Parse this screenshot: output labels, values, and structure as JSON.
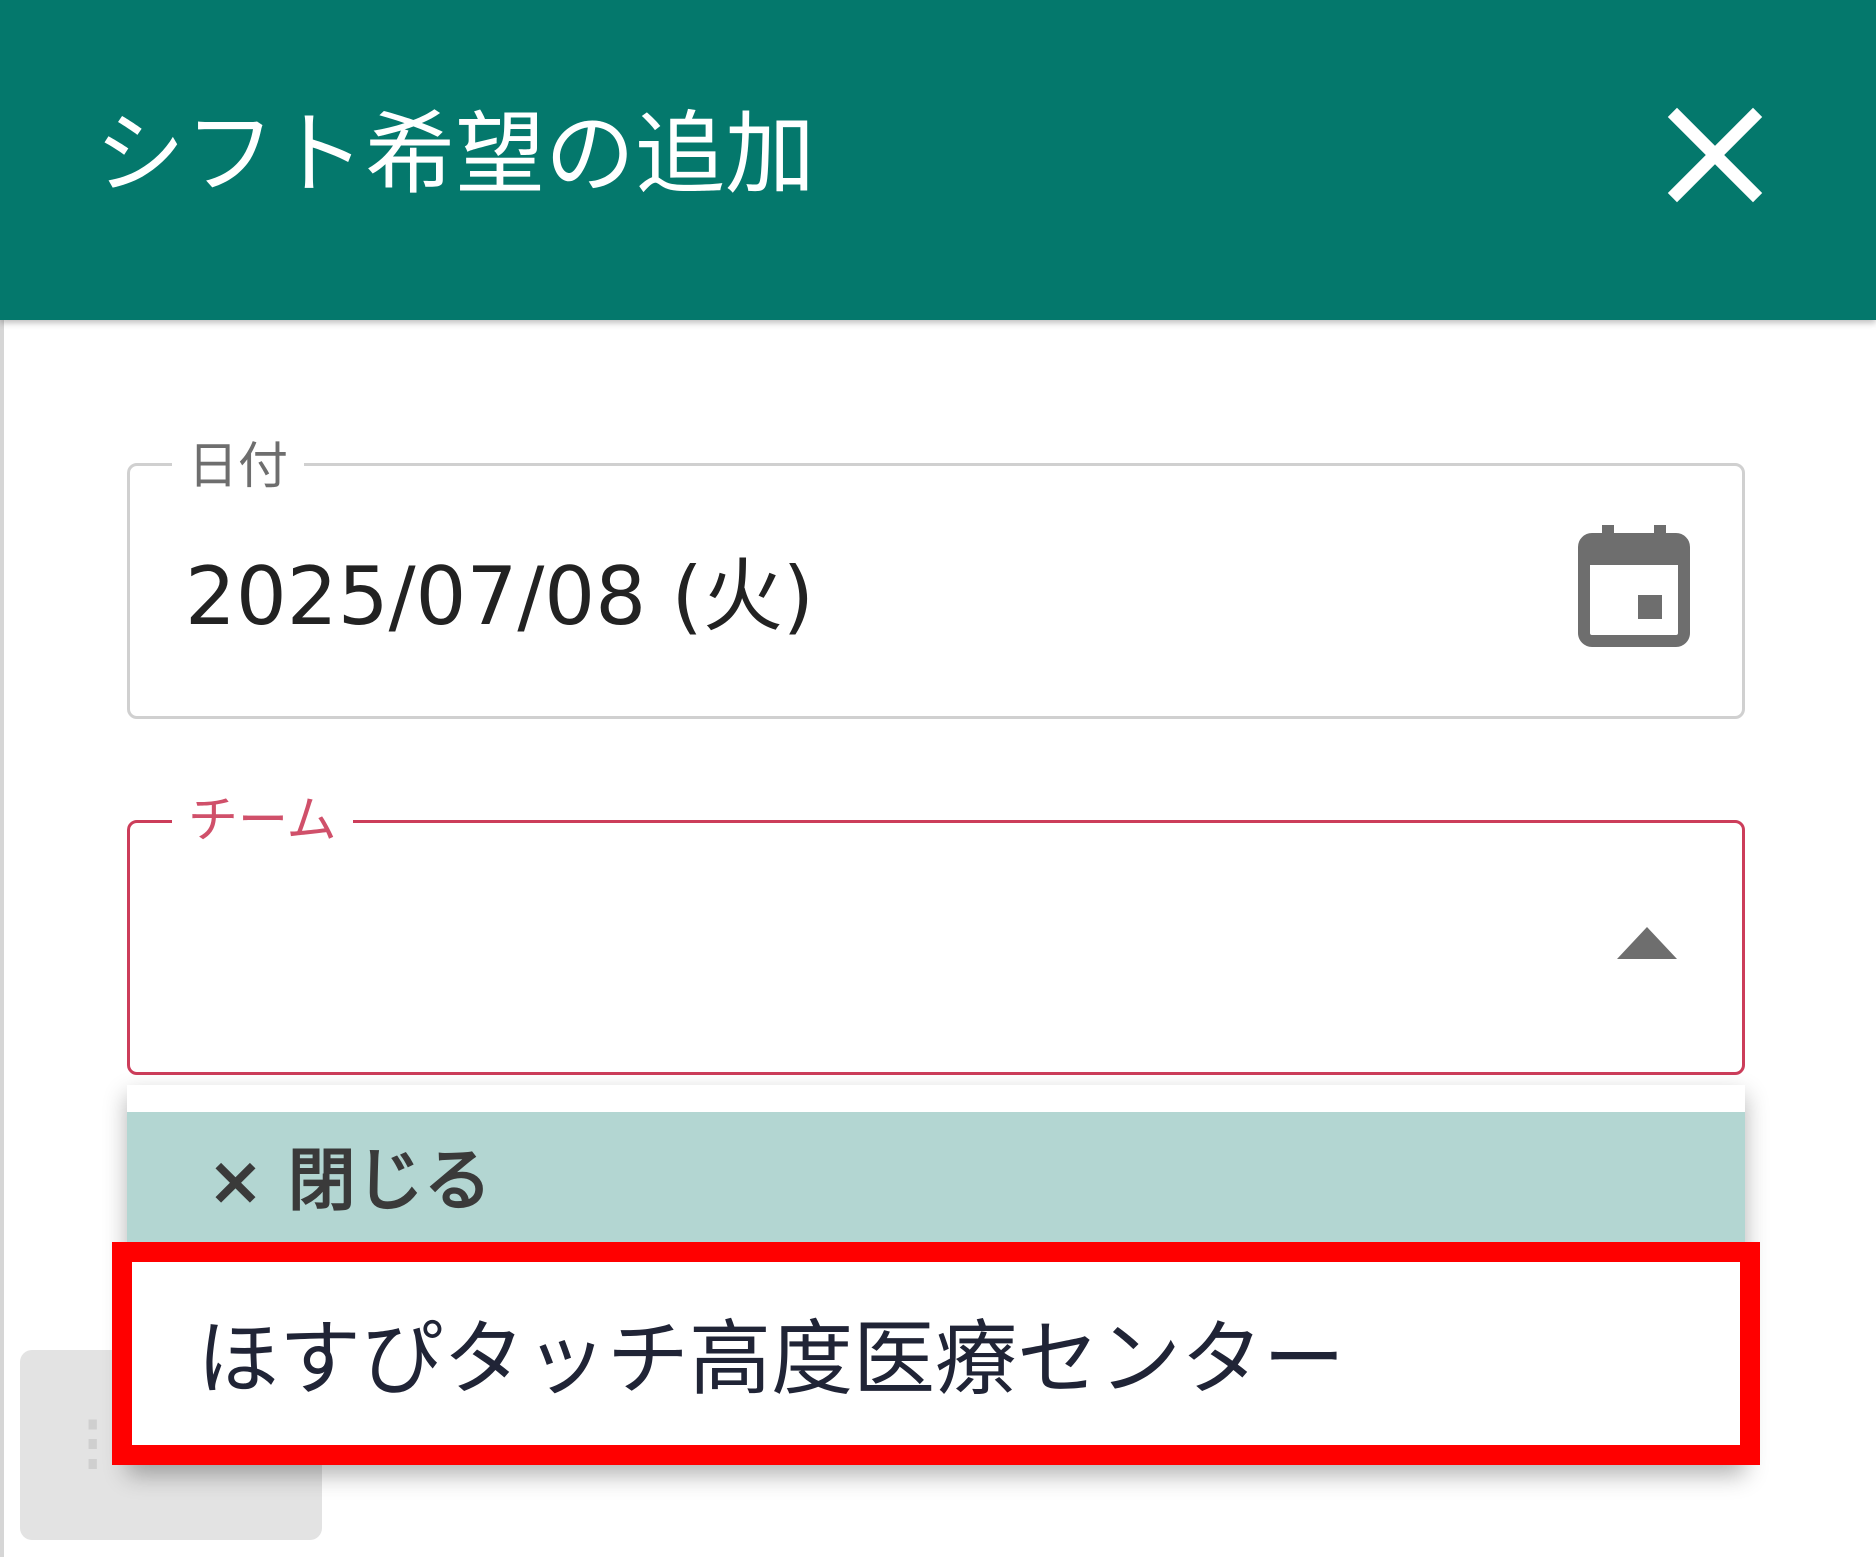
{
  "colors": {
    "header_bg": "#04786c",
    "error": "#cc3d5a",
    "close_bar_bg": "#b3d6d2",
    "highlight": "#ff0000"
  },
  "header": {
    "title": "シフト希望の追加",
    "close_icon": "close-icon"
  },
  "date_field": {
    "label": "日付",
    "value": "2025/07/08 (火)",
    "icon": "calendar-icon"
  },
  "team_field": {
    "label": "チーム",
    "value": "",
    "icon": "arrow-up-icon"
  },
  "dropdown": {
    "close_label": "× 閉じる",
    "options": [
      {
        "label": "ほすぴタッチ高度医療センター"
      }
    ]
  }
}
